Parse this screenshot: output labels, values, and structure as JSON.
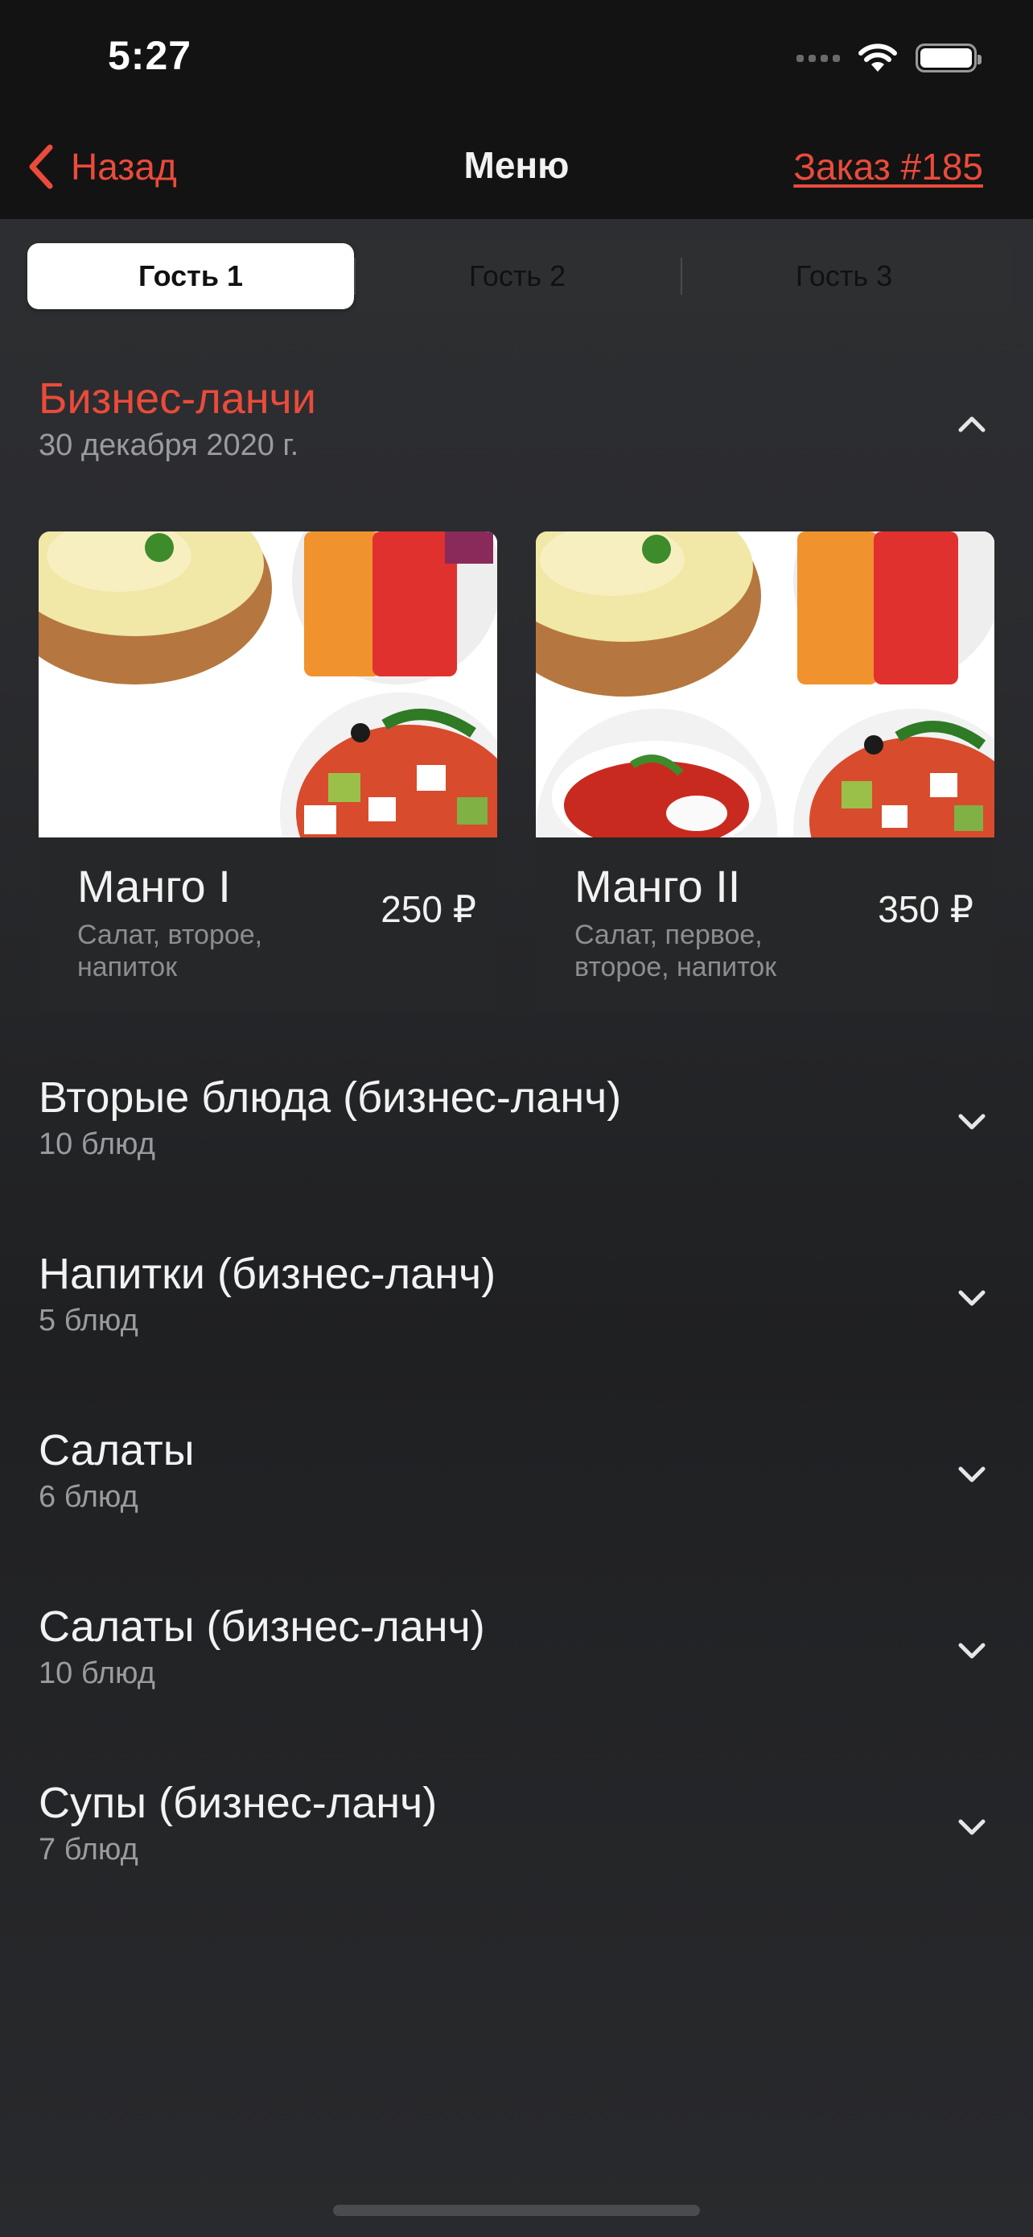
{
  "status_bar": {
    "time": "5:27"
  },
  "nav": {
    "back_label": "Назад",
    "title": "Меню",
    "order_link": "Заказ #185"
  },
  "guest_tabs": [
    "Гость 1",
    "Гость 2",
    "Гость 3"
  ],
  "active_guest_tab": "Гость 1",
  "expanded_section": {
    "title": "Бизнес-ланчи",
    "date": "30 декабря 2020 г."
  },
  "lunch_cards": [
    {
      "name": "Манго I",
      "description": "Салат, второе, напиток",
      "price": "250 ₽"
    },
    {
      "name": "Манго II",
      "description": "Салат, первое, второе, напиток",
      "price": "350 ₽"
    }
  ],
  "categories": [
    {
      "title": "Вторые блюда (бизнес-ланч)",
      "count": "10 блюд"
    },
    {
      "title": "Напитки (бизнес-ланч)",
      "count": "5 блюд"
    },
    {
      "title": "Салаты",
      "count": "6 блюд"
    },
    {
      "title": "Салаты (бизнес-ланч)",
      "count": "10 блюд"
    },
    {
      "title": "Супы (бизнес-ланч)",
      "count": "7 блюд"
    }
  ],
  "colors": {
    "accent": "#ea4b3b",
    "background": "#2a2b2e",
    "card": "#262729",
    "secondary_text": "#9a9b9e"
  }
}
